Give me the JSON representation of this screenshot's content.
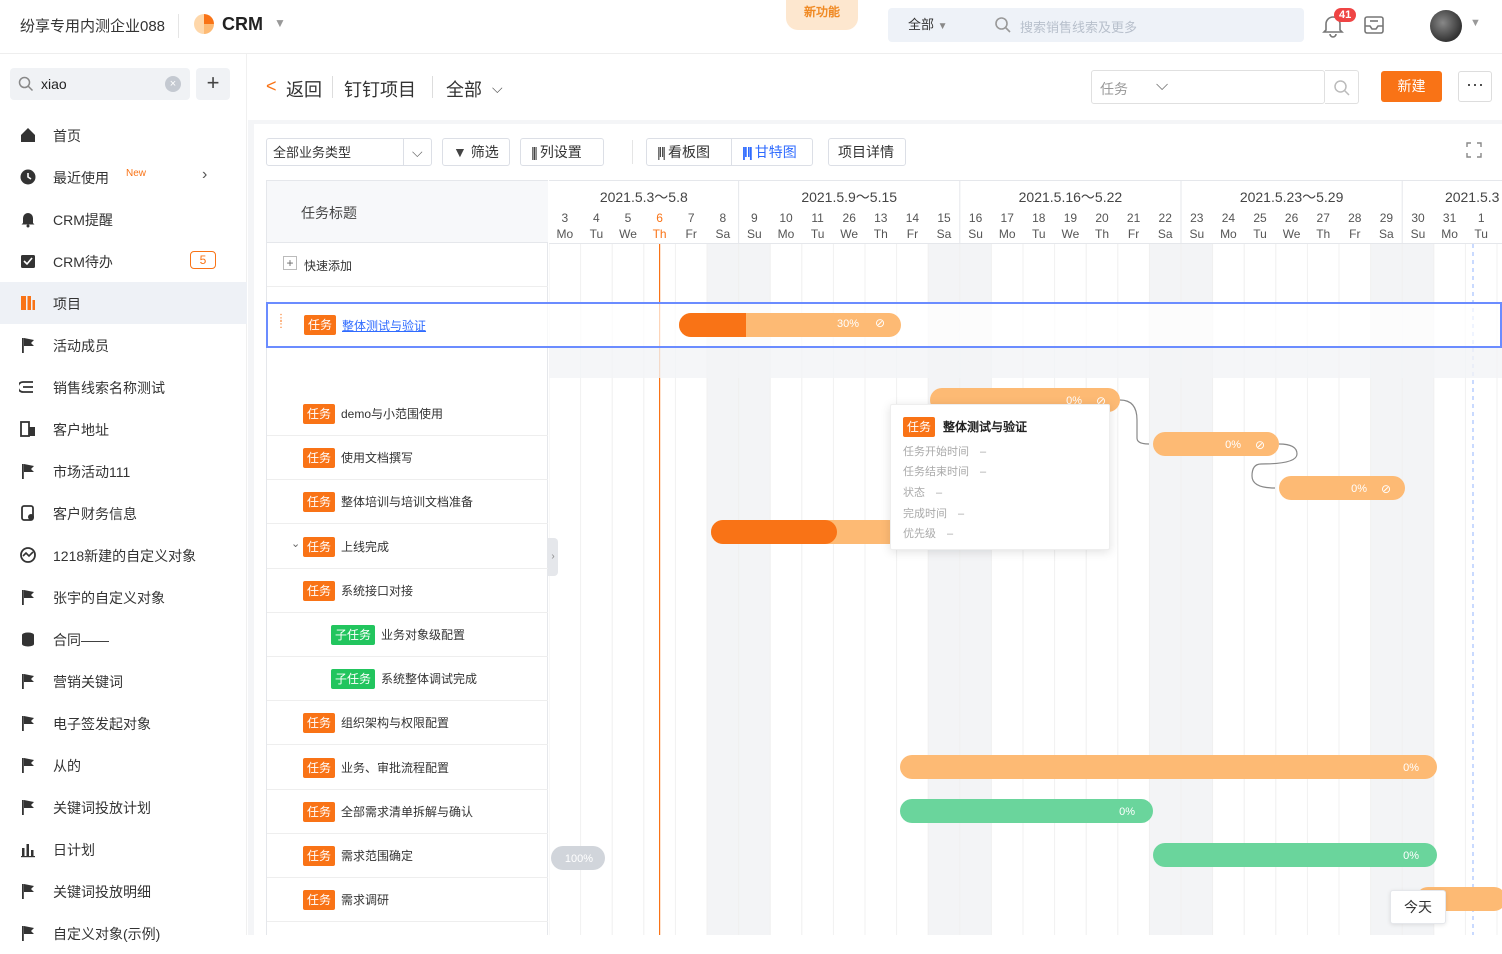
{
  "topbar": {
    "company": "纷享专用内测企业088",
    "app_name": "CRM",
    "new_feature": "新功能",
    "scope": "全部",
    "search_placeholder": "搜索销售线索及更多",
    "notification_count": "41"
  },
  "sidebar": {
    "search_value": "xiao",
    "items": [
      {
        "label": "首页",
        "icon": "home-icon"
      },
      {
        "label": "最近使用",
        "icon": "clock-icon",
        "new": "New",
        "arrow": "›"
      },
      {
        "label": "CRM提醒",
        "icon": "bell-icon"
      },
      {
        "label": "CRM待办",
        "icon": "todo-icon",
        "count": "5"
      },
      {
        "label": "项目",
        "icon": "project-icon",
        "active": true
      },
      {
        "label": "活动成员",
        "icon": "flag-icon"
      },
      {
        "label": "销售线索名称测试",
        "icon": "lead-icon"
      },
      {
        "label": "客户地址",
        "icon": "address-icon"
      },
      {
        "label": "市场活动111",
        "icon": "flag-icon"
      },
      {
        "label": "客户财务信息",
        "icon": "finance-icon"
      },
      {
        "label": "1218新建的自定义对象",
        "icon": "object-icon"
      },
      {
        "label": "张宇的自定义对象",
        "icon": "flag-icon"
      },
      {
        "label": "合同——",
        "icon": "contract-icon"
      },
      {
        "label": "营销关键词",
        "icon": "flag-icon"
      },
      {
        "label": "电子签发起对象",
        "icon": "flag-icon"
      },
      {
        "label": "从的",
        "icon": "flag-icon"
      },
      {
        "label": "关键词投放计划",
        "icon": "flag-icon"
      },
      {
        "label": "日计划",
        "icon": "bar-chart-icon"
      },
      {
        "label": "关键词投放明细",
        "icon": "flag-icon"
      },
      {
        "label": "自定义对象(示例)",
        "icon": "flag-icon"
      }
    ]
  },
  "header": {
    "back_arrow": "<",
    "back": "返回",
    "project": "钉钉项目",
    "scope": "全部",
    "task_select": "任务",
    "new_button": "新建",
    "more": "···"
  },
  "toolbar": {
    "type_select": "全部业务类型",
    "filter": "筛选",
    "columns": "列设置",
    "kanban": "看板图",
    "gantt": "甘特图",
    "details": "项目详情"
  },
  "gantt": {
    "column_title": "任务标题",
    "quick_add": "快速添加",
    "selected_row": {
      "tag": "任务",
      "title": "整体测试与验证",
      "progress": "30%"
    },
    "weeks": [
      "2021.5.3～5.8",
      "2021.5.9～5.15",
      "2021.5.16～5.22",
      "2021.5.23～5.29",
      "2021.5.3"
    ],
    "days": [
      [
        "3",
        "Mo"
      ],
      [
        "4",
        "Tu"
      ],
      [
        "5",
        "We"
      ],
      [
        "6",
        "Th"
      ],
      [
        "7",
        "Fr"
      ],
      [
        "8",
        "Sa"
      ],
      [
        "9",
        "Su"
      ],
      [
        "10",
        "Mo"
      ],
      [
        "11",
        "Tu"
      ],
      [
        "26",
        "We"
      ],
      [
        "13",
        "Th"
      ],
      [
        "14",
        "Fr"
      ],
      [
        "15",
        "Sa"
      ],
      [
        "16",
        "Su"
      ],
      [
        "17",
        "Mo"
      ],
      [
        "18",
        "Tu"
      ],
      [
        "19",
        "We"
      ],
      [
        "20",
        "Th"
      ],
      [
        "21",
        "Fr"
      ],
      [
        "22",
        "Sa"
      ],
      [
        "23",
        "Su"
      ],
      [
        "24",
        "Mo"
      ],
      [
        "25",
        "Tu"
      ],
      [
        "26",
        "We"
      ],
      [
        "27",
        "Th"
      ],
      [
        "28",
        "Fr"
      ],
      [
        "29",
        "Sa"
      ],
      [
        "30",
        "Su"
      ],
      [
        "31",
        "Mo"
      ],
      [
        "1",
        "Tu"
      ],
      [
        "2",
        "We"
      ]
    ],
    "rows": [
      {
        "tag": "任务",
        "title": "demo与小范围使用"
      },
      {
        "tag": "任务",
        "title": "使用文档撰写"
      },
      {
        "tag": "任务",
        "title": "整体培训与培训文档准备"
      },
      {
        "tag": "任务",
        "title": "上线完成",
        "caret": "⌄"
      },
      {
        "tag": "任务",
        "title": "系统接口对接"
      },
      {
        "tag": "子任务",
        "title": "业务对象级配置"
      },
      {
        "tag": "子任务",
        "title": "系统整体调试完成"
      },
      {
        "tag": "任务",
        "title": "组织架构与权限配置"
      },
      {
        "tag": "任务",
        "title": "业务、审批流程配置"
      },
      {
        "tag": "任务",
        "title": "全部需求清单拆解与确认"
      },
      {
        "tag": "任务",
        "title": "需求范围确定"
      },
      {
        "tag": "任务",
        "title": "需求调研"
      }
    ],
    "bar_labels": [
      "0%",
      "0%",
      "0%",
      "0%",
      "0%",
      "0%",
      "100%"
    ],
    "today": "今天",
    "colors": {
      "orange": "#f97316",
      "light_orange": "#fdba74",
      "green": "#6ad59c",
      "gray": "#d1d5db"
    }
  },
  "tooltip": {
    "tag": "任务",
    "title": "整体测试与验证",
    "fields": [
      "任务开始时间　–",
      "任务结束时间　–",
      "状态　–",
      "完成时间　–",
      "优先级　–"
    ]
  }
}
